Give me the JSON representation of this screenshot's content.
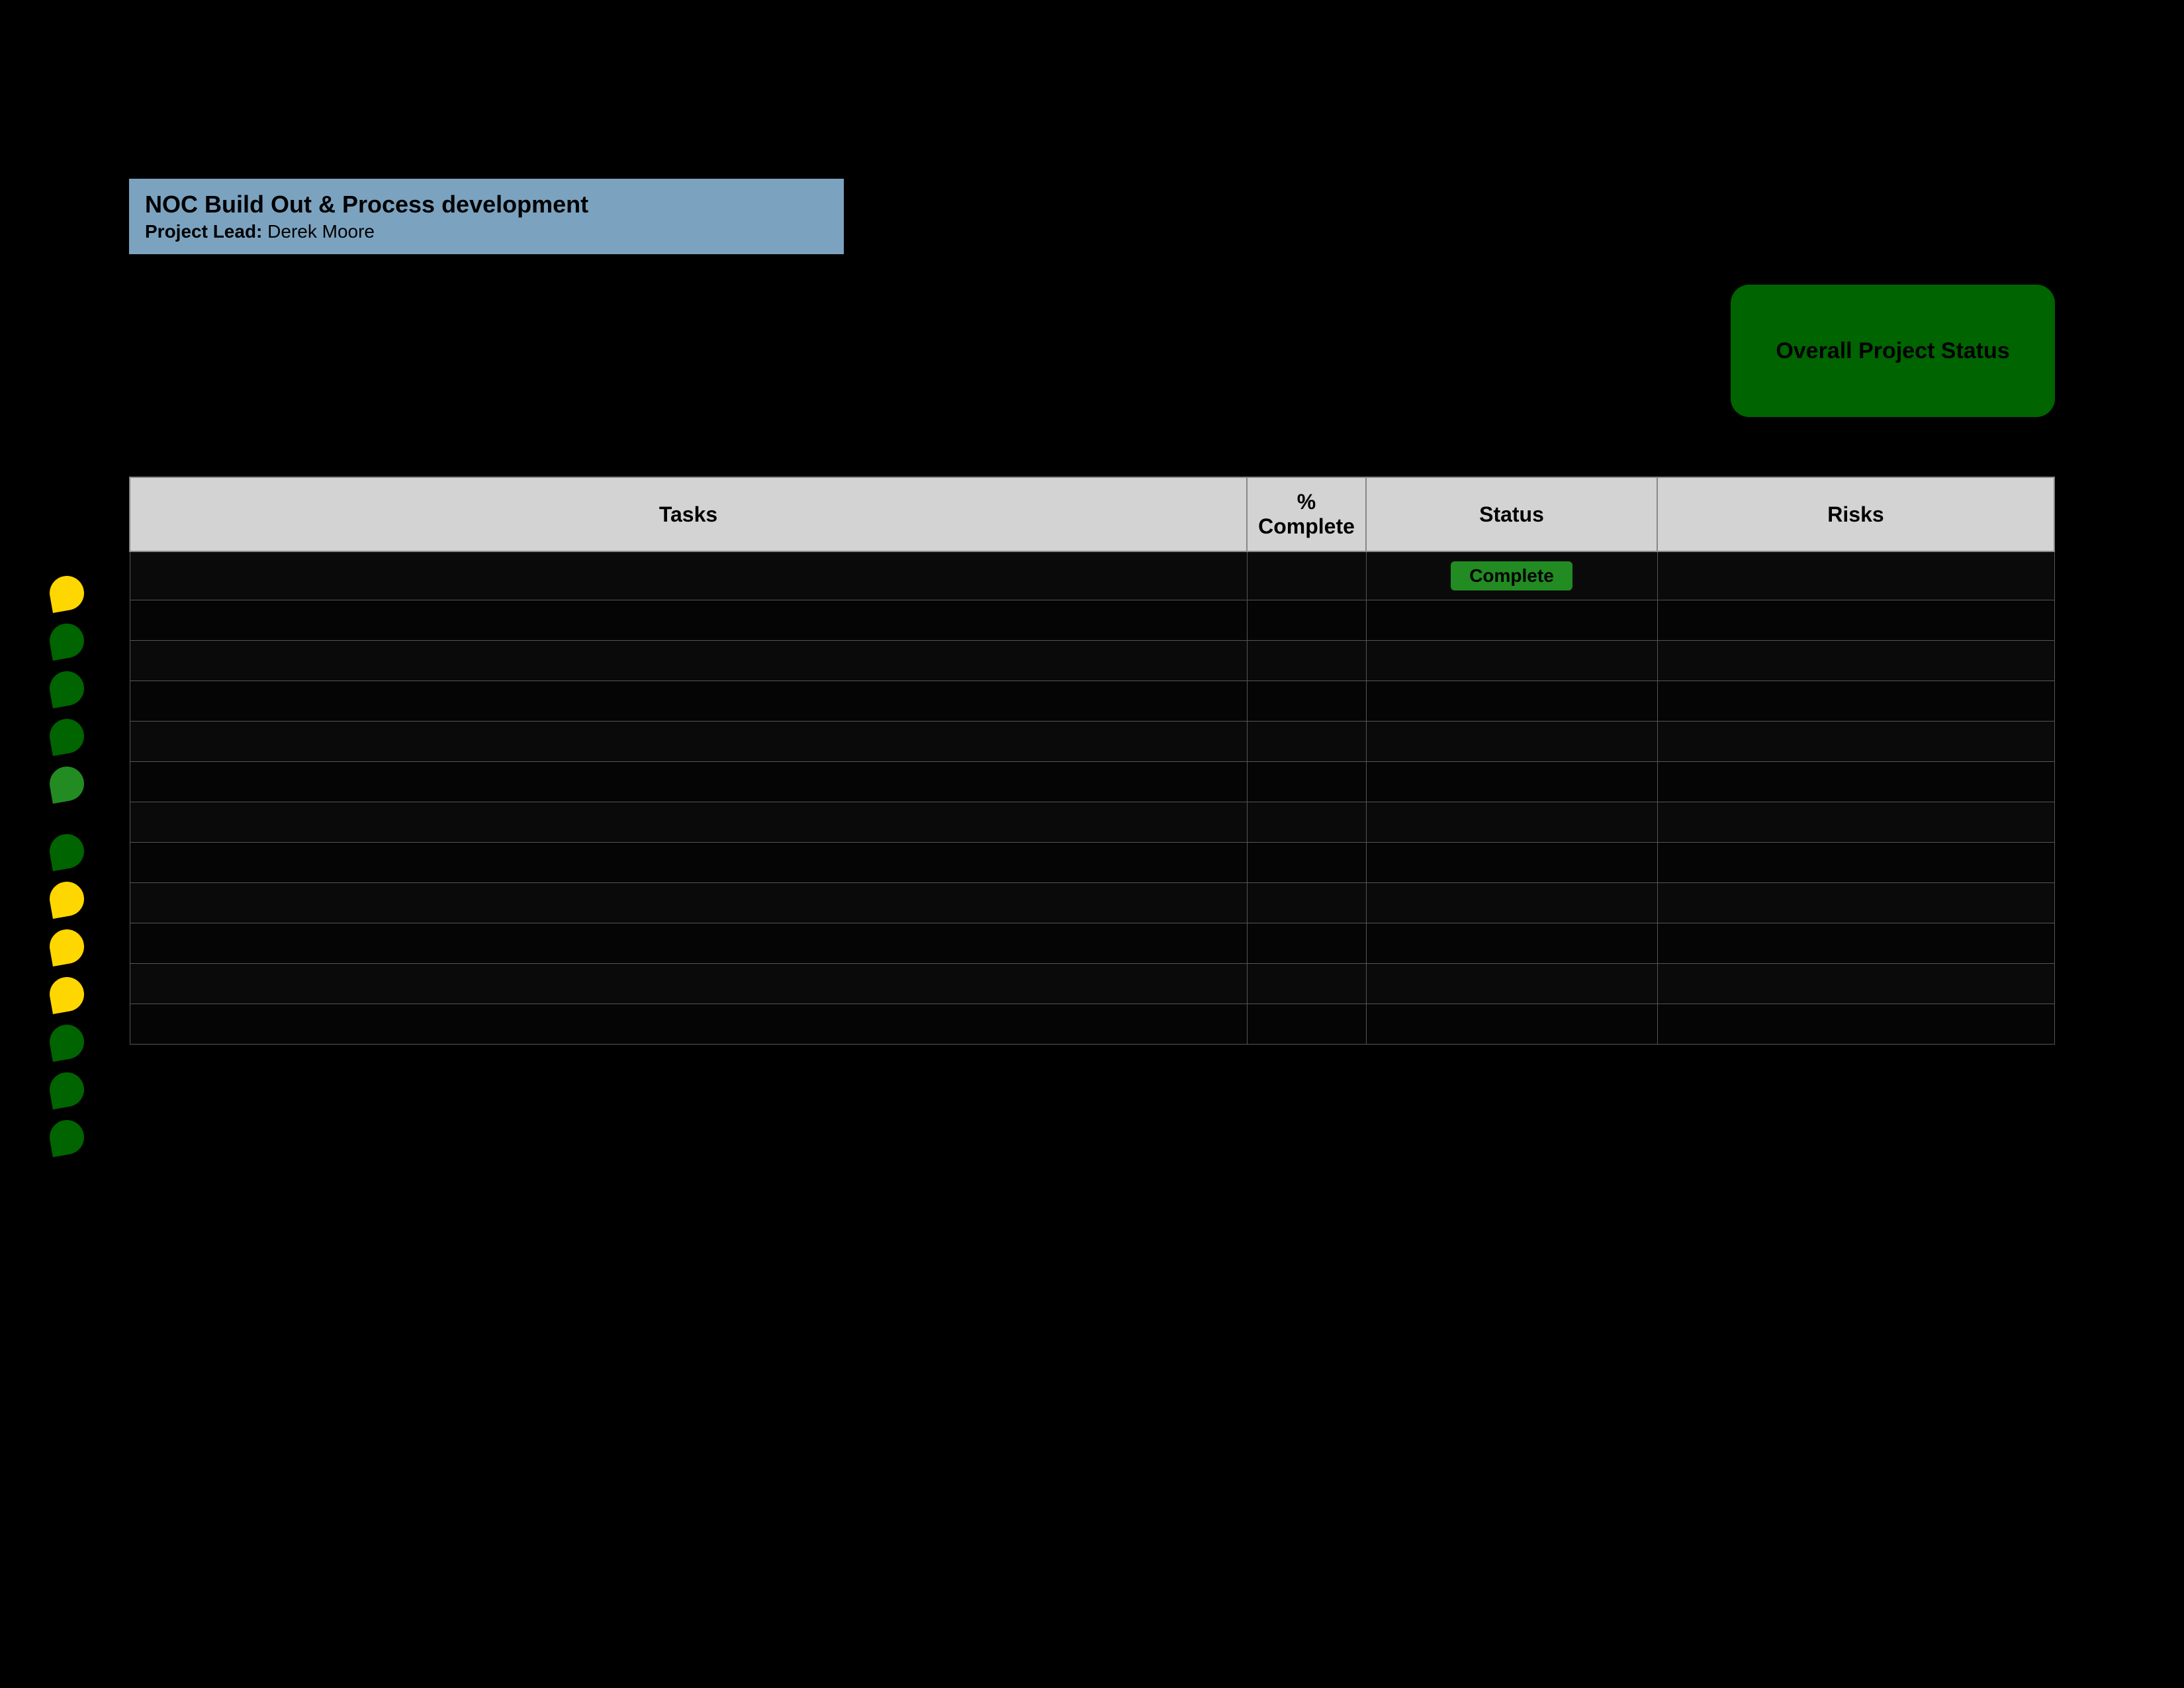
{
  "project": {
    "title": "NOC Build Out & Process development",
    "lead_label": "Project Lead:",
    "lead_name": "Derek Moore"
  },
  "overall_status": {
    "label": "Overall Project Status",
    "color": "#006400"
  },
  "table": {
    "headers": [
      "Tasks",
      "% Complete",
      "Status",
      "Risks"
    ],
    "rows": [
      {
        "indicator": "yellow",
        "task": "",
        "complete": "",
        "status": "",
        "risks": ""
      },
      {
        "indicator": "green-dark",
        "task": "",
        "complete": "",
        "status": "",
        "risks": ""
      },
      {
        "indicator": "green-dark",
        "task": "",
        "complete": "",
        "status": "",
        "risks": ""
      },
      {
        "indicator": "green-dark",
        "task": "",
        "complete": "",
        "status": "",
        "risks": ""
      },
      {
        "indicator": "green-med",
        "task": "",
        "complete": "",
        "status": "",
        "risks": ""
      },
      {
        "indicator": "green-dark",
        "task": "",
        "complete": "",
        "status": "",
        "risks": ""
      },
      {
        "indicator": "yellow",
        "task": "",
        "complete": "",
        "status": "",
        "risks": ""
      },
      {
        "indicator": "yellow",
        "task": "",
        "complete": "",
        "status": "",
        "risks": ""
      },
      {
        "indicator": "yellow",
        "task": "",
        "complete": "",
        "status": "",
        "risks": ""
      },
      {
        "indicator": "green-dark",
        "task": "",
        "complete": "",
        "status": "",
        "risks": ""
      },
      {
        "indicator": "green-dark",
        "task": "",
        "complete": "",
        "status": "",
        "risks": ""
      },
      {
        "indicator": "green-dark",
        "task": "",
        "complete": "",
        "status": "",
        "risks": ""
      }
    ]
  },
  "status_badge": {
    "complete_label": "Complete"
  },
  "colors": {
    "background": "#000000",
    "header_bg": "#7ba3c0",
    "overall_status_bg": "#006400",
    "table_header_bg": "#d3d3d3",
    "yellow": "#FFD700",
    "green_dark": "#006400",
    "green_med": "#228B22"
  }
}
